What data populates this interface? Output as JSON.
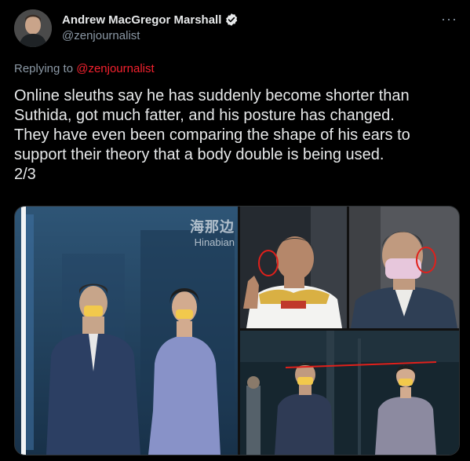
{
  "author": {
    "name": "Andrew MacGregor Marshall",
    "handle": "@zenjournalist",
    "verified": true
  },
  "reply": {
    "prefix": "Replying to ",
    "to": "@zenjournalist"
  },
  "tweet": {
    "text": "Online sleuths say he has suddenly become shorter than\nSuthida, got much fatter, and his posture has changed.\nThey have even been comparing the shape of his ears to\nsupport their theory that a body double is being used.\n2/3"
  },
  "media": {
    "watermark_cn": "海那边",
    "watermark_en": "Hinabian"
  },
  "icons": {
    "more": "more-options-icon",
    "verified": "verified-badge-icon"
  },
  "colors": {
    "background": "#000000",
    "text": "#e7e9ea",
    "secondary_text": "#8b98a5",
    "reply_link": "#f4212e",
    "annotation": "#e0201b"
  }
}
